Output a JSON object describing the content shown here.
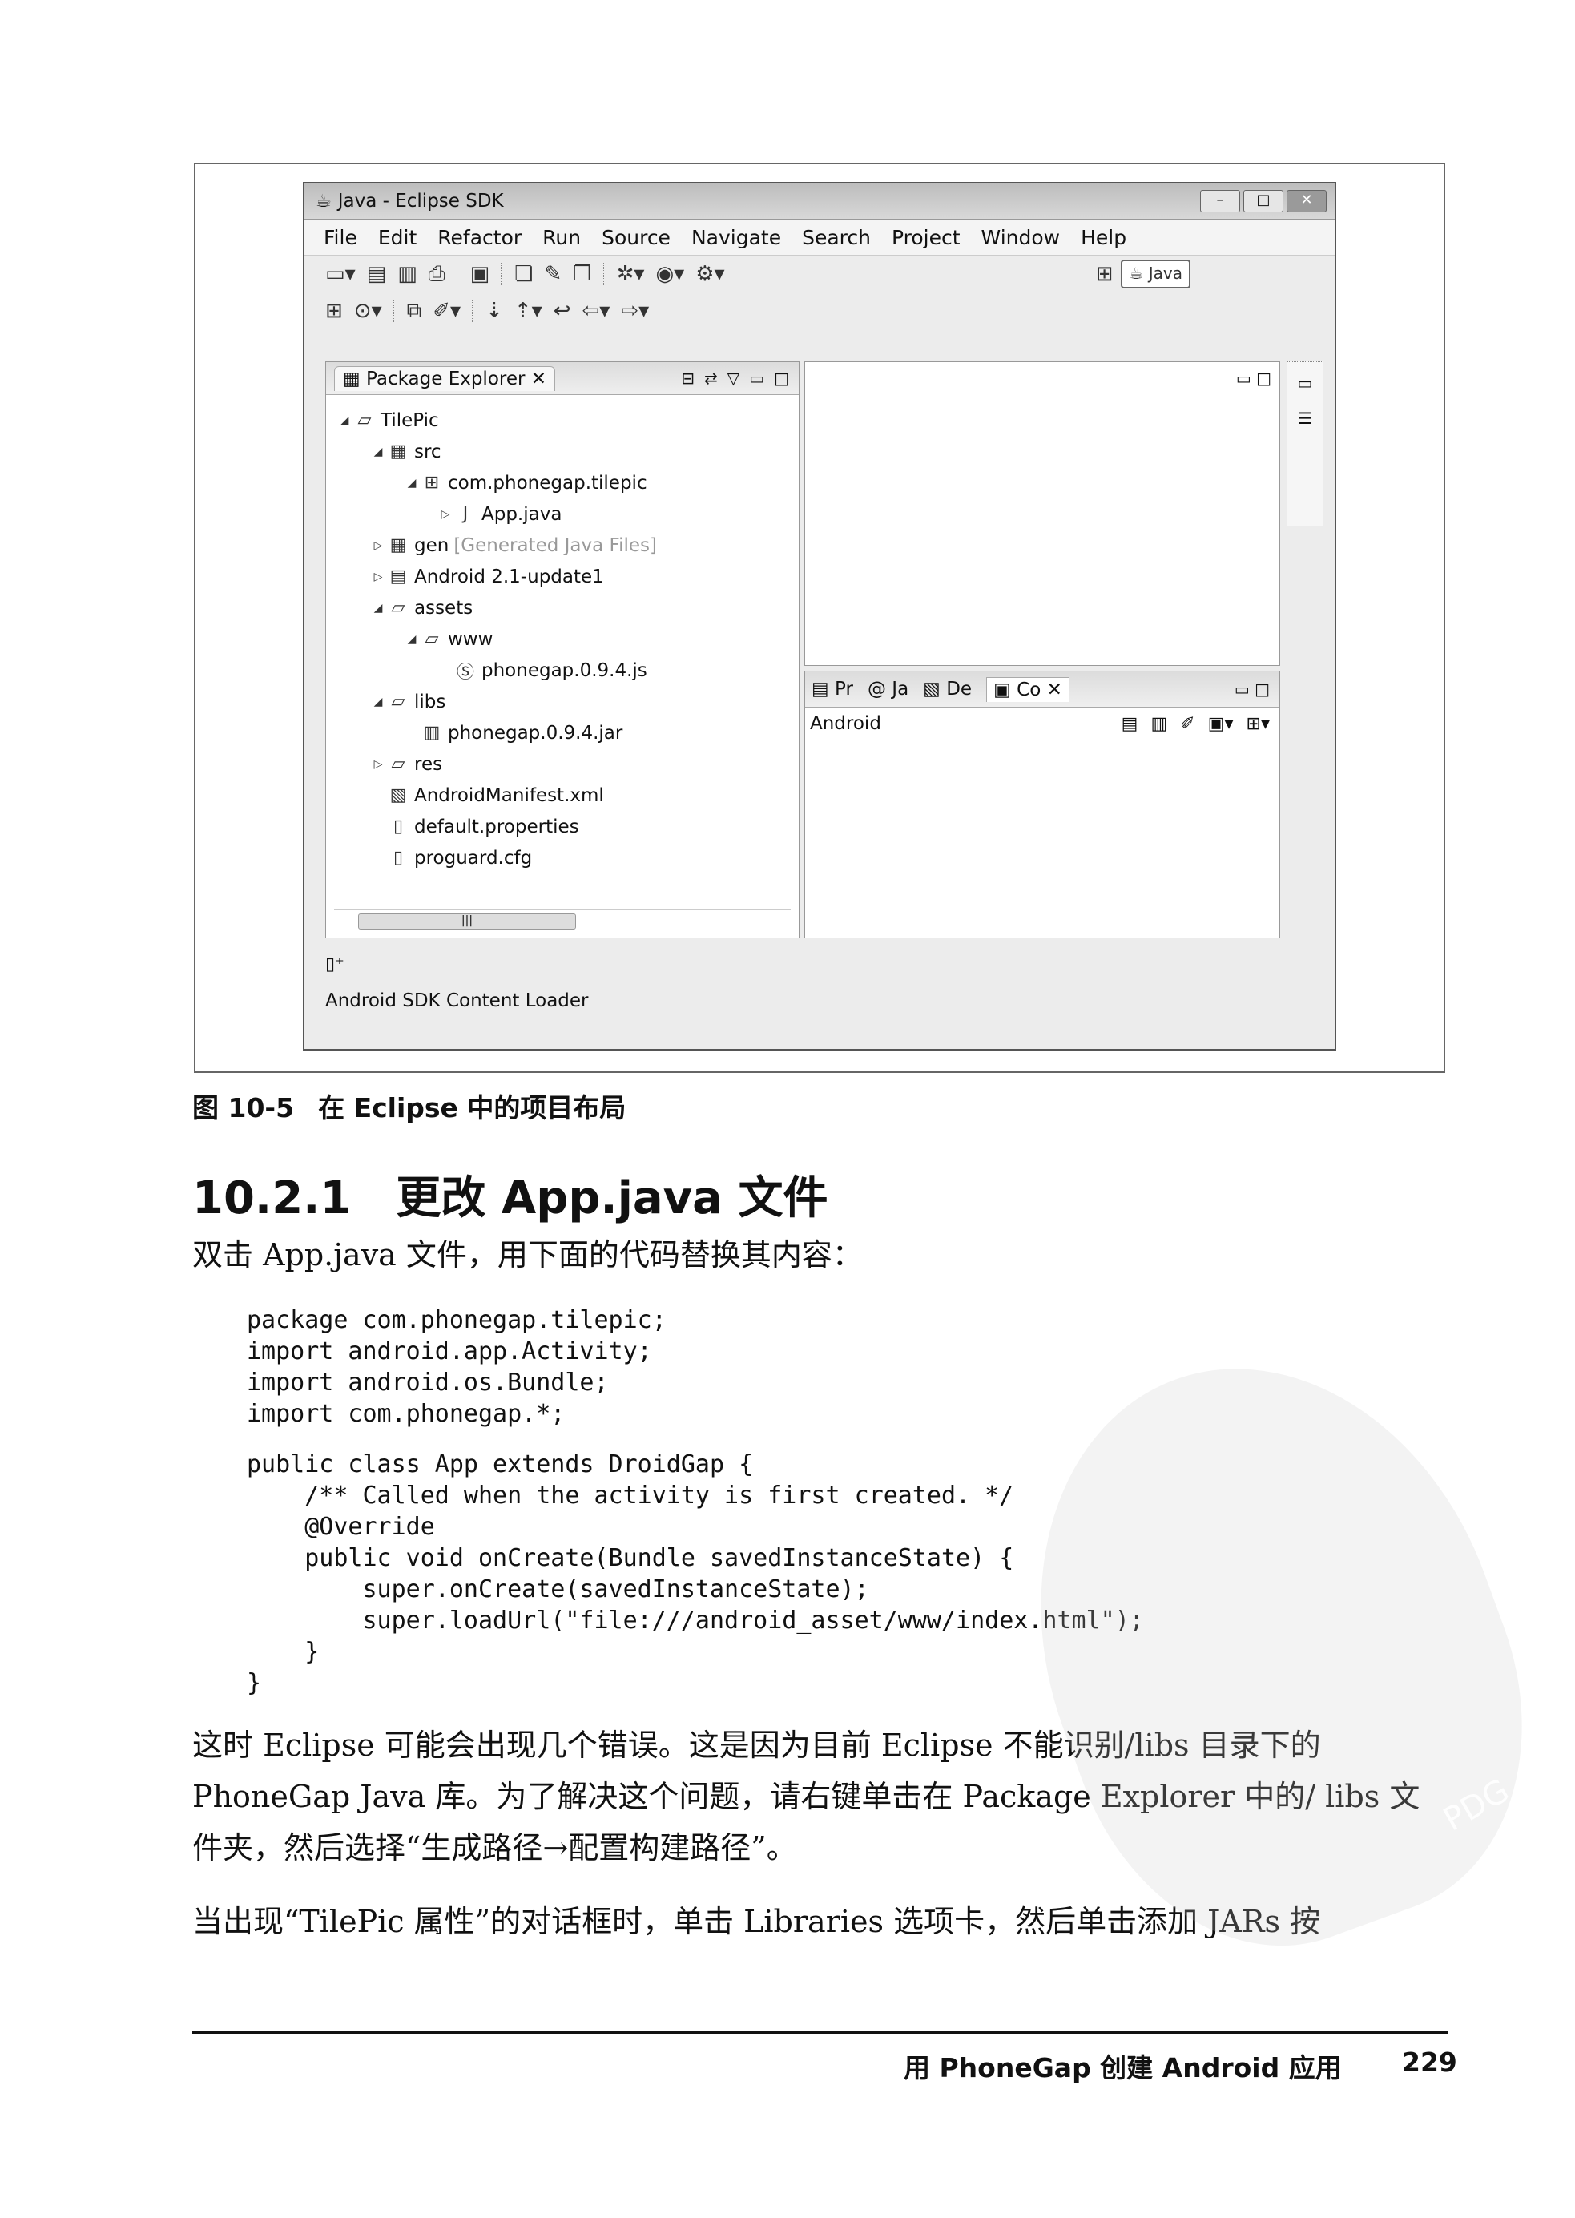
{
  "window": {
    "title": "Java - Eclipse SDK",
    "menu": [
      "File",
      "Edit",
      "Refactor",
      "Run",
      "Source",
      "Navigate",
      "Search",
      "Project",
      "Window",
      "Help"
    ],
    "perspective_label": "Java"
  },
  "package_explorer": {
    "tab_label": "Package Explorer",
    "tree": [
      {
        "label": "TilePic",
        "depth": 0,
        "twisty": "open",
        "icon": "project-icon"
      },
      {
        "label": "src",
        "depth": 1,
        "twisty": "open",
        "icon": "source-folder-icon"
      },
      {
        "label": "com.phonegap.tilepic",
        "depth": 2,
        "twisty": "open",
        "icon": "package-icon"
      },
      {
        "label": "App.java",
        "depth": 3,
        "twisty": "closed",
        "icon": "java-file-icon"
      },
      {
        "label": "gen",
        "suffix": "[Generated Java Files]",
        "depth": 1,
        "twisty": "closed",
        "icon": "source-folder-icon"
      },
      {
        "label": "Android 2.1-update1",
        "depth": 1,
        "twisty": "closed",
        "icon": "library-icon"
      },
      {
        "label": "assets",
        "depth": 1,
        "twisty": "open",
        "icon": "folder-icon"
      },
      {
        "label": "www",
        "depth": 2,
        "twisty": "open",
        "icon": "folder-icon"
      },
      {
        "label": "phonegap.0.9.4.js",
        "depth": 3,
        "twisty": "none",
        "icon": "js-file-icon"
      },
      {
        "label": "libs",
        "depth": 1,
        "twisty": "open",
        "icon": "folder-icon"
      },
      {
        "label": "phonegap.0.9.4.jar",
        "depth": 2,
        "twisty": "none",
        "icon": "jar-file-icon"
      },
      {
        "label": "res",
        "depth": 1,
        "twisty": "closed",
        "icon": "folder-icon"
      },
      {
        "label": "AndroidManifest.xml",
        "depth": 1,
        "twisty": "none",
        "icon": "xml-file-icon"
      },
      {
        "label": "default.properties",
        "depth": 1,
        "twisty": "none",
        "icon": "file-icon"
      },
      {
        "label": "proguard.cfg",
        "depth": 1,
        "twisty": "none",
        "icon": "file-icon"
      }
    ]
  },
  "console": {
    "tabs": [
      "Pr",
      "Ja",
      "De",
      "Co"
    ],
    "row_label": "Android"
  },
  "status": {
    "text": "Android SDK Content Loader"
  },
  "caption": {
    "number": "图 10-5",
    "text": "在 Eclipse 中的项目布局"
  },
  "section": {
    "number": "10.2.1",
    "title": "更改 App.java 文件"
  },
  "intro": "双击 App.java 文件，用下面的代码替换其内容：",
  "code_block_1": "package com.phonegap.tilepic;\nimport android.app.Activity;\nimport android.os.Bundle;\nimport com.phonegap.*;",
  "code_block_2": "public class App extends DroidGap {\n    /** Called when the activity is first created. */\n    @Override\n    public void onCreate(Bundle savedInstanceState) {\n        super.onCreate(savedInstanceState);\n        super.loadUrl(\"file:///android_asset/www/index.html\");\n    }\n}",
  "para_1": "这时 Eclipse 可能会出现几个错误。这是因为目前 Eclipse 不能识别/libs 目录下的 PhoneGap Java 库。为了解决这个问题，请右键单击在 Package Explorer 中的/ libs 文件夹，然后选择“生成路径→配置构建路径”。",
  "para_2": "当出现“TilePic 属性”的对话框时，单击 Libraries 选项卡，然后单击添加 JARs 按",
  "footer": {
    "title": "用 PhoneGap 创建 Android 应用",
    "page": "229"
  },
  "watermark_text": "PDG"
}
